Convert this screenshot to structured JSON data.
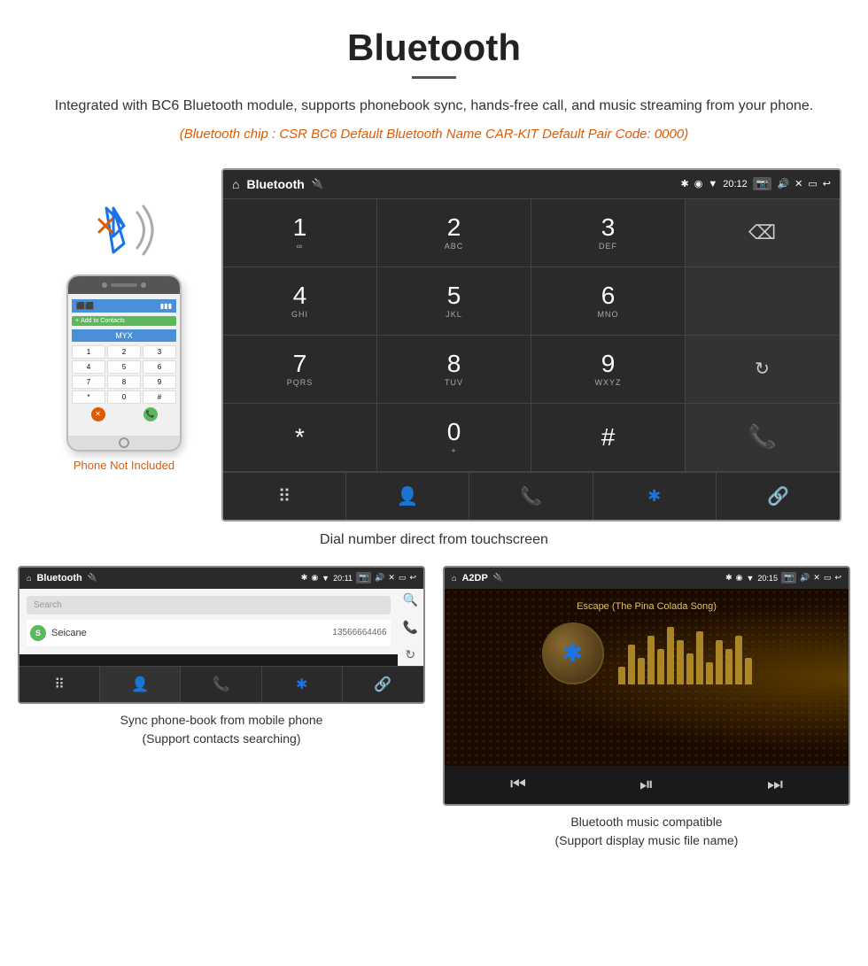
{
  "header": {
    "title": "Bluetooth",
    "divider": true,
    "description": "Integrated with BC6 Bluetooth module, supports phonebook sync, hands-free call, and music streaming from your phone.",
    "chip_info": "(Bluetooth chip : CSR BC6    Default Bluetooth Name CAR-KIT    Default Pair Code: 0000)"
  },
  "phone_area": {
    "not_included_label": "Phone Not Included"
  },
  "dialpad_screen": {
    "status_bar": {
      "title": "Bluetooth",
      "time": "20:12"
    },
    "keys": [
      {
        "number": "1",
        "letters": ""
      },
      {
        "number": "2",
        "letters": "ABC"
      },
      {
        "number": "3",
        "letters": "DEF"
      },
      {
        "number": "",
        "letters": ""
      },
      {
        "number": "4",
        "letters": "GHI"
      },
      {
        "number": "5",
        "letters": "JKL"
      },
      {
        "number": "6",
        "letters": "MNO"
      },
      {
        "number": "",
        "letters": ""
      },
      {
        "number": "7",
        "letters": "PQRS"
      },
      {
        "number": "8",
        "letters": "TUV"
      },
      {
        "number": "9",
        "letters": "WXYZ"
      },
      {
        "number": "",
        "letters": ""
      },
      {
        "number": "*",
        "letters": ""
      },
      {
        "number": "0",
        "letters": "+"
      },
      {
        "number": "#",
        "letters": ""
      },
      {
        "number": "",
        "letters": ""
      }
    ]
  },
  "dial_caption": "Dial number direct from touchscreen",
  "phonebook_screen": {
    "status_bar": {
      "title": "Bluetooth",
      "time": "20:11"
    },
    "search_placeholder": "Search",
    "contacts": [
      {
        "initial": "S",
        "name": "Seicane",
        "phone": "13566664466"
      }
    ]
  },
  "phonebook_caption": "Sync phone-book from mobile phone\n(Support contacts searching)",
  "music_screen": {
    "status_bar": {
      "title": "A2DP",
      "time": "20:15"
    },
    "song_title": "Escape (The Pina Colada Song)"
  },
  "music_caption": "Bluetooth music compatible\n(Support display music file name)",
  "eq_bars": [
    20,
    45,
    30,
    55,
    40,
    65,
    50,
    35,
    60,
    25,
    50,
    40,
    55,
    30
  ]
}
